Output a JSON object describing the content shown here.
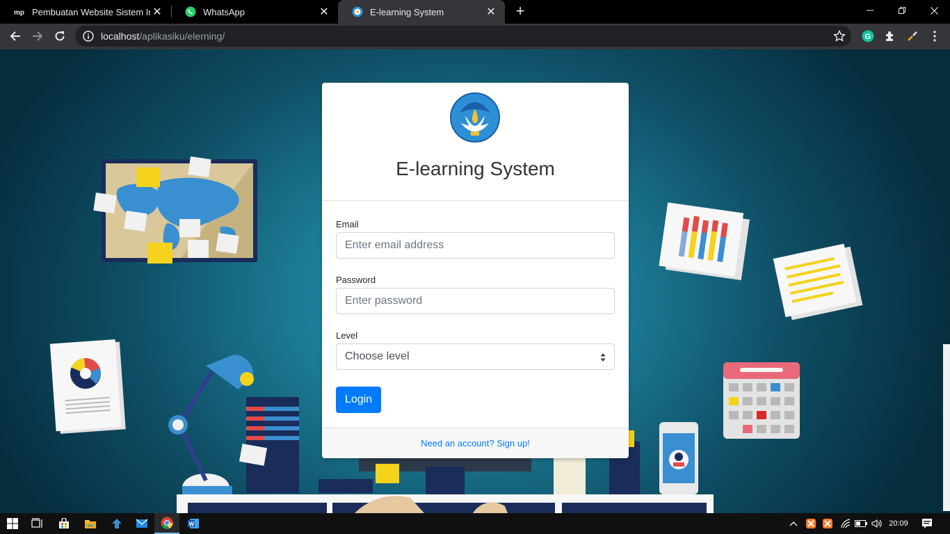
{
  "browser": {
    "tabs": [
      {
        "title": "Pembuatan Website Sistem Infor",
        "favicon": "mp-icon"
      },
      {
        "title": "WhatsApp",
        "favicon": "whatsapp-icon"
      },
      {
        "title": "E-learning System",
        "favicon": "tutwuri-icon",
        "active": true
      }
    ],
    "address": {
      "host": "localhost",
      "path": "/aplikasiku/elerning/"
    }
  },
  "login": {
    "title": "E-learning System",
    "email_label": "Email",
    "email_placeholder": "Enter email address",
    "password_label": "Password",
    "password_placeholder": "Enter password",
    "level_label": "Level",
    "level_selected": "Choose level",
    "login_button": "Login",
    "signup_link": "Need an account? Sign up!"
  },
  "taskbar": {
    "clock": "20:09"
  },
  "colors": {
    "primary": "#007bff",
    "background": "#1b7892",
    "chrome_dark": "#35363a"
  }
}
